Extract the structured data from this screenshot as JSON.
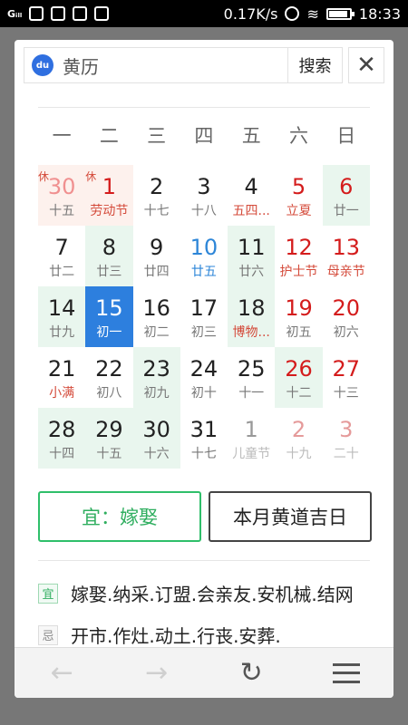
{
  "status_bar": {
    "signal": "Gᵢₗₗ",
    "speed": "0.17K/s",
    "time": "18:33"
  },
  "search": {
    "query": "黄历",
    "search_label": "搜索",
    "close_label": "✕",
    "logo_text": "du"
  },
  "weekdays": [
    "一",
    "二",
    "三",
    "四",
    "五",
    "六",
    "日"
  ],
  "calendar": {
    "rows": [
      [
        {
          "num": "30",
          "sub": "十五",
          "tag": "休"
        },
        {
          "num": "1",
          "sub": "劳动节",
          "tag": "休"
        },
        {
          "num": "2",
          "sub": "十七"
        },
        {
          "num": "3",
          "sub": "十八"
        },
        {
          "num": "4",
          "sub": "五四..."
        },
        {
          "num": "5",
          "sub": "立夏"
        },
        {
          "num": "6",
          "sub": "廿一"
        }
      ],
      [
        {
          "num": "7",
          "sub": "廿二"
        },
        {
          "num": "8",
          "sub": "廿三"
        },
        {
          "num": "9",
          "sub": "廿四"
        },
        {
          "num": "10",
          "sub": "廿五"
        },
        {
          "num": "11",
          "sub": "廿六"
        },
        {
          "num": "12",
          "sub": "护士节"
        },
        {
          "num": "13",
          "sub": "母亲节"
        }
      ],
      [
        {
          "num": "14",
          "sub": "廿九"
        },
        {
          "num": "15",
          "sub": "初一"
        },
        {
          "num": "16",
          "sub": "初二"
        },
        {
          "num": "17",
          "sub": "初三"
        },
        {
          "num": "18",
          "sub": "博物..."
        },
        {
          "num": "19",
          "sub": "初五"
        },
        {
          "num": "20",
          "sub": "初六"
        }
      ],
      [
        {
          "num": "21",
          "sub": "小满"
        },
        {
          "num": "22",
          "sub": "初八"
        },
        {
          "num": "23",
          "sub": "初九"
        },
        {
          "num": "24",
          "sub": "初十"
        },
        {
          "num": "25",
          "sub": "十一"
        },
        {
          "num": "26",
          "sub": "十二"
        },
        {
          "num": "27",
          "sub": "十三"
        }
      ],
      [
        {
          "num": "28",
          "sub": "十四"
        },
        {
          "num": "29",
          "sub": "十五"
        },
        {
          "num": "30",
          "sub": "十六"
        },
        {
          "num": "31",
          "sub": "十七"
        },
        {
          "num": "1",
          "sub": "儿童节"
        },
        {
          "num": "2",
          "sub": "十九"
        },
        {
          "num": "3",
          "sub": "二十"
        }
      ]
    ]
  },
  "buttons": {
    "yi": "宜：嫁娶",
    "lucky_days": "本月黄道吉日"
  },
  "info": {
    "yi_badge": "宜",
    "yi_text": "嫁娶.纳采.订盟.会亲友.安机械.结网",
    "ji_badge": "忌",
    "ji_text": "开市.作灶.动土.行丧.安葬."
  },
  "toolbar": {
    "back": "←",
    "forward": "→",
    "refresh": "↻"
  }
}
